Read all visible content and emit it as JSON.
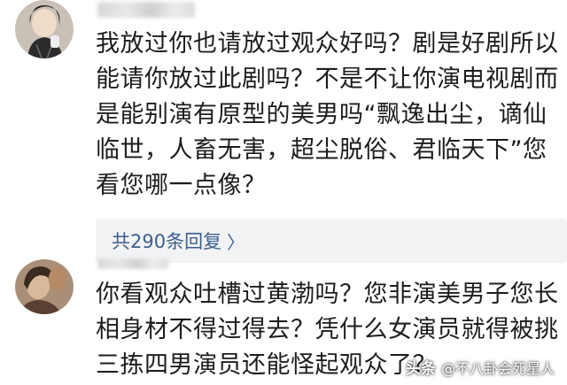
{
  "comments": [
    {
      "text_lines": [
        "我放过你也请放过观众好吗？剧是好剧所以",
        "能请你放过此剧吗？不是不让你演电视剧而",
        "是能别演有原型的美男吗“飘逸出尘，谪仙",
        "临世，人畜无害，超尘脱俗、君临天下”您",
        "看您哪一点像？"
      ],
      "replies_label": "共290条回复",
      "replies_chevron": "〉"
    },
    {
      "text_lines": [
        "你看观众吐槽过黄渤吗？您非演美男子您长",
        "相身材不得过得去？凭什么女演员就得被挑",
        "三拣四男演员还能怪起观众了？"
      ]
    }
  ],
  "watermark": {
    "logo": "头条",
    "handle": "@不八卦会死星人"
  },
  "colors": {
    "text": "#1d1d1d",
    "link": "#3a5f8f",
    "reply_bg": "#f2f3f5"
  }
}
